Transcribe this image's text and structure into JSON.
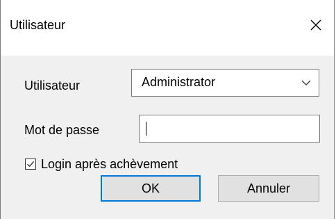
{
  "window": {
    "title": "Utilisateur",
    "close_icon": "close-icon"
  },
  "form": {
    "user_label": "Utilisateur",
    "user_value": "Administrator",
    "password_label": "Mot de passe",
    "password_value": "",
    "login_after_label": "Login après achèvement",
    "login_after_checked": true
  },
  "buttons": {
    "ok_label": "OK",
    "cancel_label": "Annuler"
  },
  "colors": {
    "accent": "#0078d7",
    "dialog_background": "#f0f0f0",
    "title_background": "#ffffff",
    "border": "#7a7a7a"
  }
}
